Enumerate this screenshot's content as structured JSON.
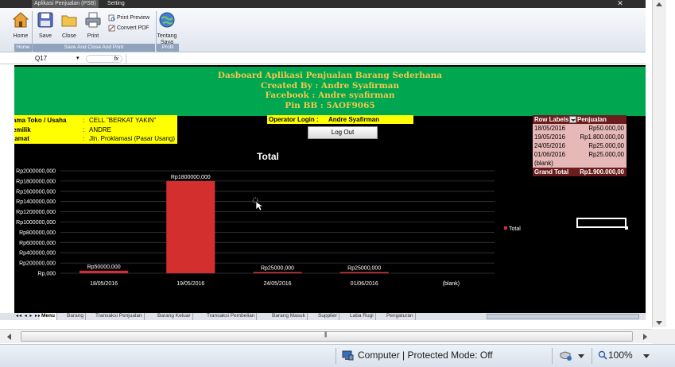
{
  "titlebar": {
    "tabs": [
      "Aplikasi Penjualan (PSB)",
      "Setting"
    ],
    "close_glyph": "✕"
  },
  "ribbon": {
    "buttons": [
      {
        "label": "Home",
        "icon": "home-icon"
      },
      {
        "label": "Save",
        "icon": "save-icon"
      },
      {
        "label": "Close",
        "icon": "close-folder-icon"
      },
      {
        "label": "Print",
        "icon": "printer-icon"
      }
    ],
    "small_buttons": [
      {
        "label": "Print Preview",
        "icon": "print-preview-icon"
      },
      {
        "label": "Convert PDF",
        "icon": "convert-pdf-icon"
      }
    ],
    "about_button": {
      "label_line1": "Tentang",
      "label_line2": "Saya",
      "icon": "globe-icon"
    },
    "groups": [
      "Home",
      "Save And Close And Print",
      "Profil"
    ]
  },
  "formula_bar": {
    "name_box": "Q17",
    "fx": "fx",
    "value": ""
  },
  "banner": {
    "line1": "Dasboard Aplikasi Penjualan Barang Sederhana",
    "line2": "Created By : Andre Syafirman",
    "line3": "Facebook : Andre syafirman",
    "line4": "Pin BB : 5AOF9065"
  },
  "store_info": {
    "rows": [
      {
        "label": "ama Toko / Usaha",
        "colon": ":",
        "value": "CELL \"BERKAT YAKIN\""
      },
      {
        "label": "emilik",
        "colon": ":",
        "value": "ANDRE"
      },
      {
        "label": "lamat",
        "colon": ":",
        "value": "Jln. Proklamasi (Pasar Usang)"
      }
    ]
  },
  "operator": {
    "label": "Operator Login :",
    "value": "Andre Syafirman"
  },
  "logout_label": "Log Out",
  "pivot": {
    "header_a": "Row Labels",
    "header_b": "Penjualan",
    "rows": [
      {
        "date": "18/05/2016",
        "amount": "Rp50.000,00"
      },
      {
        "date": "19/05/2016",
        "amount": "Rp1.800.000,00"
      },
      {
        "date": "24/05/2016",
        "amount": "Rp25.000,00"
      },
      {
        "date": "01/06/2016",
        "amount": "Rp25.000,00"
      },
      {
        "date": "(blank)",
        "amount": ""
      }
    ],
    "total_label": "Grand Total",
    "total_value": "Rp1.900.000,00"
  },
  "chart_data": {
    "type": "bar",
    "title": "Total",
    "categories": [
      "18/05/2016",
      "19/05/2016",
      "24/05/2016",
      "01/06/2016",
      "(blank)"
    ],
    "series": [
      {
        "name": "Total",
        "values": [
          50000,
          1800000,
          25000,
          25000,
          null
        ]
      }
    ],
    "data_labels": [
      "Rp50000,000",
      "Rp1800000,000",
      "Rp25000,000",
      "Rp25000,000",
      ""
    ],
    "y_ticks": [
      "Rp,000",
      "Rp200000,000",
      "Rp400000,000",
      "Rp600000,000",
      "Rp800000,000",
      "Rp1000000,000",
      "Rp1200000,000",
      "Rp1400000,000",
      "Rp1600000,000",
      "Rp1800000,000",
      "Rp2000000,000"
    ],
    "ylim": [
      0,
      2000000
    ],
    "grid": true,
    "legend": "right",
    "bar_color": "#d32f2f",
    "background": "#000000"
  },
  "sheet_tabs": {
    "nav_glyphs": "◂◂ ◂ ▸ ▸▸",
    "tabs": [
      "Menu",
      "Barang",
      "Transaksi Penjualan",
      "Barang Keluar",
      "Transaksi Pembelian",
      "Barang Masuk",
      "Supplier",
      "Laba Rugi",
      "Pengaturan"
    ],
    "active": "Menu"
  },
  "hscroll": {
    "grip": "|||"
  },
  "statusbar": {
    "protected_mode": "Computer | Protected Mode: Off",
    "zoom": "100%"
  }
}
